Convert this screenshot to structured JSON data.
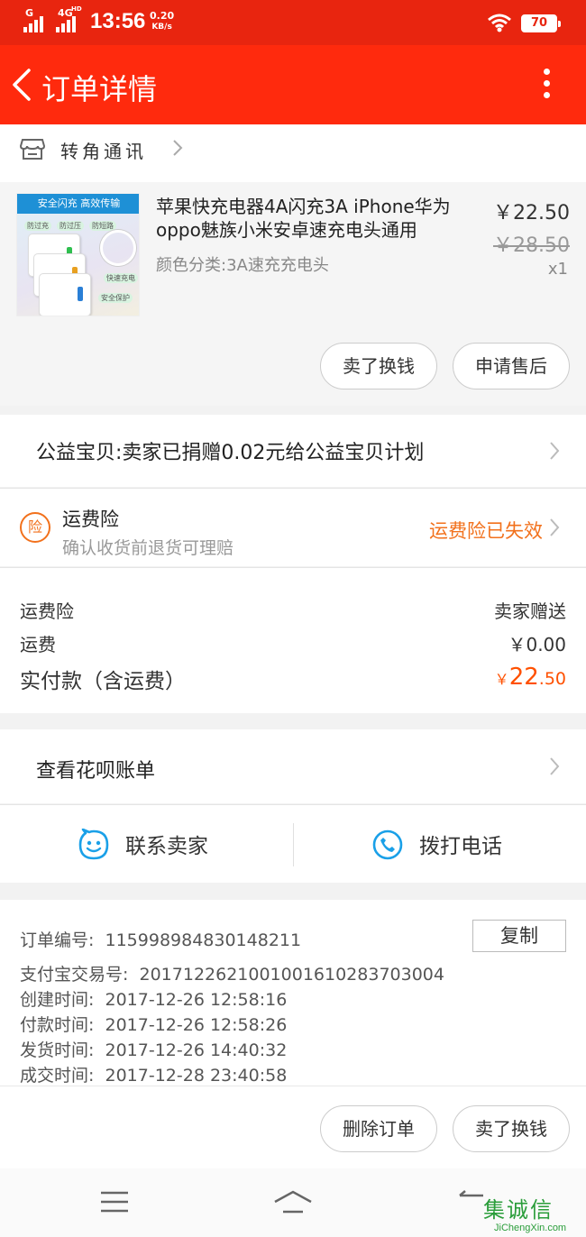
{
  "status_bar": {
    "network_1": "G",
    "network_2": "4G",
    "network_2_sup": "HD",
    "time": "13:56",
    "speed_value": "0.20",
    "speed_unit": "KB/s",
    "battery": "70"
  },
  "header": {
    "title": "订单详情"
  },
  "shop": {
    "name": "转角通讯"
  },
  "item": {
    "title": "苹果快充电器4A闪充3A iPhone华为oppo魅族小米安卓速充电头通用",
    "spec": "颜色分类:3A速充充电头",
    "price": "￥22.50",
    "original_price": "￥28.50",
    "quantity": "x1",
    "thumb_banner": "安全闪充 高效传输",
    "thumb_tags": [
      "防过充",
      "防过压",
      "防短路",
      "快速充电",
      "安全保护"
    ],
    "actions": [
      "卖了换钱",
      "申请售后"
    ]
  },
  "charity": {
    "text": "公益宝贝:卖家已捐赠0.02元给公益宝贝计划"
  },
  "insurance": {
    "badge": "险",
    "title": "运费险",
    "subtitle": "确认收货前退货可理赔",
    "status": "运费险已失效"
  },
  "summary": {
    "rows": [
      {
        "label": "运费险",
        "value": "卖家赠送"
      },
      {
        "label": "运费",
        "value": "￥0.00"
      }
    ],
    "paid_label": "实付款（含运费）",
    "paid_currency": "￥",
    "paid_int": "22",
    "paid_dec": ".50"
  },
  "huabei": {
    "text": "查看花呗账单"
  },
  "contact": {
    "seller": "联系卖家",
    "call": "拨打电话"
  },
  "order_info": {
    "order_no_label": "订单编号:",
    "order_no": "115998984830148211",
    "copy": "复制",
    "alipay_label": "支付宝交易号:",
    "alipay_no": "2017122621001001610283703004",
    "created_label": "创建时间:",
    "created": "2017-12-26 12:58:16",
    "paid_label": "付款时间:",
    "paid": "2017-12-26 12:58:26",
    "shipped_label": "发货时间:",
    "shipped": "2017-12-26 14:40:32",
    "done_label": "成交时间:",
    "done": "2017-12-28 23:40:58"
  },
  "bottom_actions": [
    "删除订单",
    "卖了换钱"
  ],
  "watermark": {
    "main": "集诚信",
    "sub": "JiChengXin.com"
  },
  "colors": {
    "status_bar": "#e8250f",
    "app_bar": "#ff2a0d",
    "accent_orange": "#f2711c",
    "price_orange": "#ff5000",
    "icon_blue": "#1aa0e8"
  },
  "icons": {
    "back": "chevron-left-icon",
    "more": "more-vertical-icon",
    "shop": "store-icon",
    "chevron": "chevron-right-icon",
    "contact_seller": "chat-face-icon",
    "call": "phone-icon",
    "nav_menu": "menu-icon",
    "nav_home": "home-icon",
    "nav_back": "back-icon"
  }
}
